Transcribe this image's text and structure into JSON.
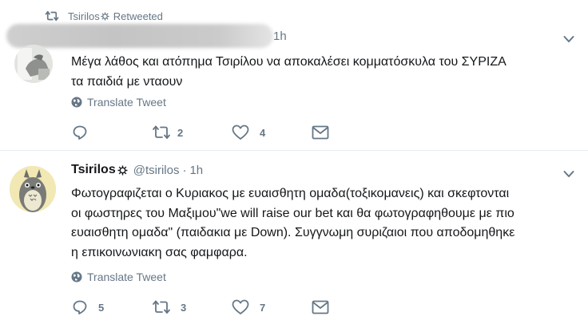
{
  "tweet1": {
    "context_user": "Tsirilos",
    "context_label": "Retweeted",
    "time": "1h",
    "text_lines": [
      "Μέγα λάθος και ατόπημα Τσιρίλου να αποκαλέσει κομματόσκυλα του ΣΥΡΙΖΑ",
      "τα παιδιά με νταουν"
    ],
    "translate": "Translate Tweet",
    "reply_count": "",
    "retweet_count": "2",
    "like_count": "4"
  },
  "tweet2": {
    "name": "Tsirilos",
    "handle": "@tsirilos",
    "dot": "·",
    "time": "1h",
    "text_lines": [
      "Φωτογραφιζεται ο Κυριακος με ευαισθητη ομαδα(τοξικομανεις) και σκεφτονται",
      "οι φωστηρες του Μαξιμου\"we will raise our bet και θα φωτογραφηθουμε με πιο",
      "ευαισθητη ομαδα\" (παιδακια με Down). Συγγνωμη συριζαιοι που αποδομηθηκε",
      "η επικοινωνιακη σας φαμφαρα."
    ],
    "translate": "Translate Tweet",
    "reply_count": "5",
    "retweet_count": "3",
    "like_count": "7"
  },
  "colors": {
    "secondary": "#657786",
    "text": "#14171a",
    "divider": "#e6ecf0"
  },
  "icons": [
    "retweet-icon",
    "verified-badge-icon",
    "chevron-down-icon",
    "globe-icon",
    "reply-icon",
    "like-icon",
    "message-icon"
  ]
}
